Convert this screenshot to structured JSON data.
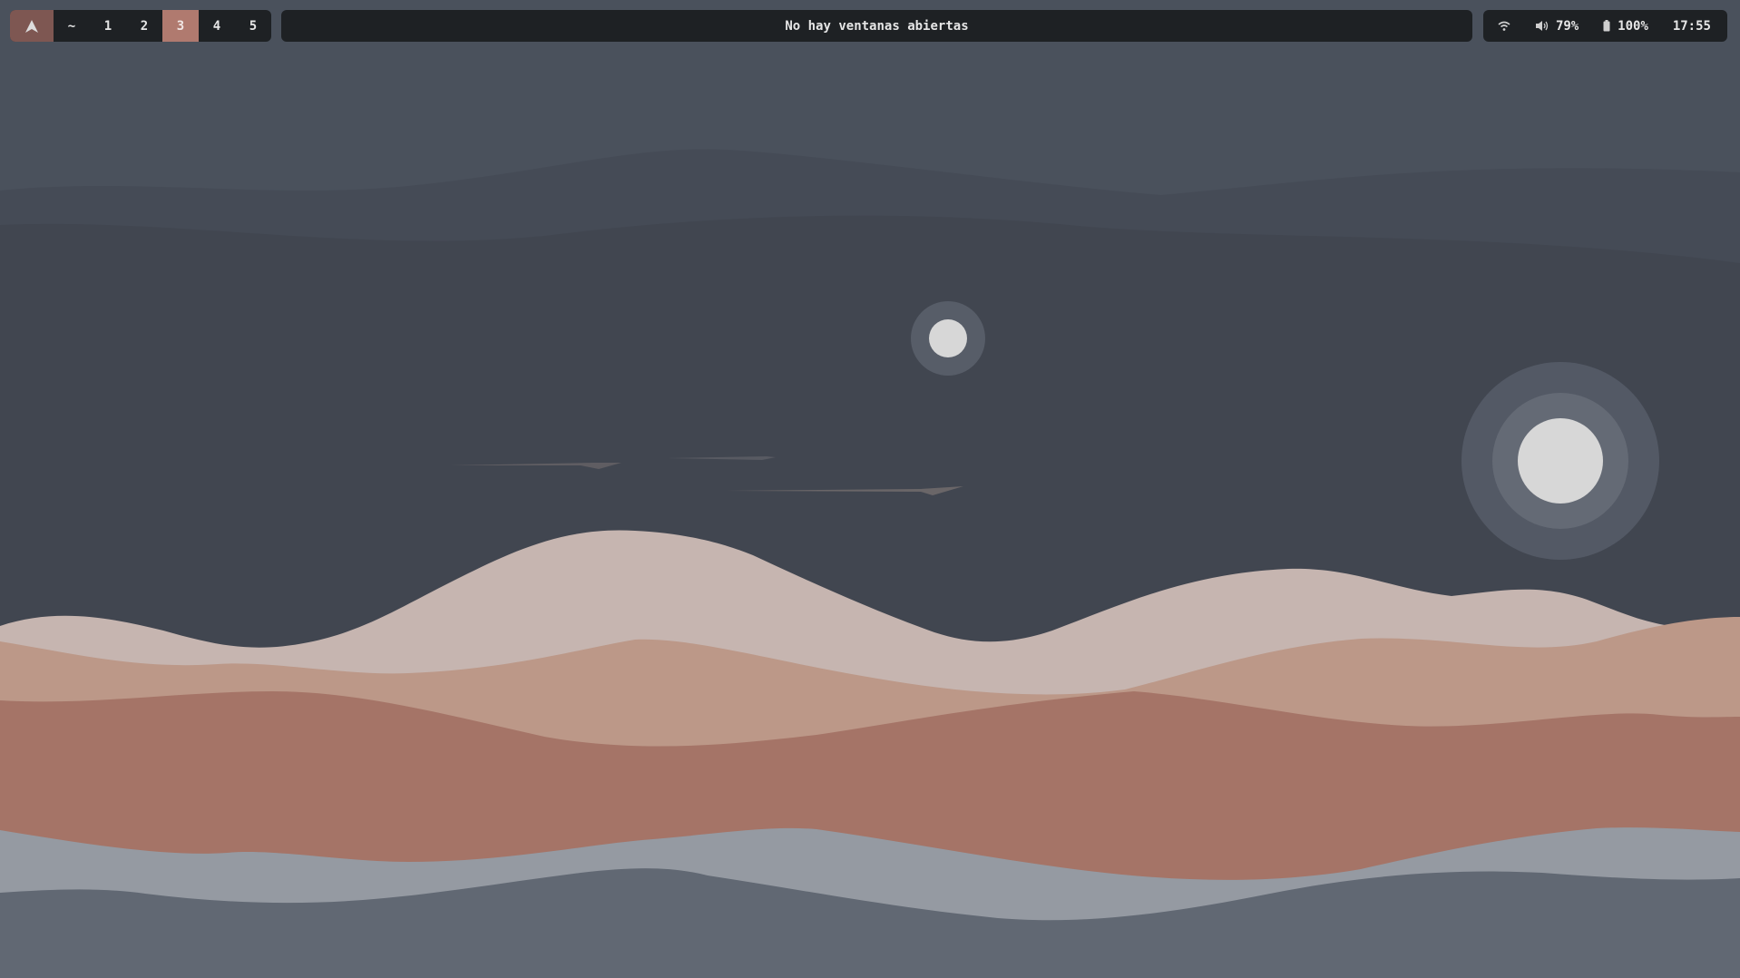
{
  "workspaces": {
    "logo_icon": "arch-logo-icon",
    "items": [
      {
        "label": "~"
      },
      {
        "label": "1"
      },
      {
        "label": "2"
      },
      {
        "label": "3",
        "active": true
      },
      {
        "label": "4"
      },
      {
        "label": "5"
      }
    ]
  },
  "window_title": "No hay ventanas abiertas",
  "status": {
    "wifi_icon": "wifi-icon",
    "volume_icon": "volume-icon",
    "volume": "79%",
    "battery_icon": "battery-icon",
    "battery": "100%",
    "clock": "17:55"
  },
  "colors": {
    "bar_bg": "#1e2124",
    "active_workspace": "#b07a6f",
    "logo_bg": "#7e5752",
    "sky_top": "#4a515c",
    "sky_bottom": "#414650",
    "dune_light": "#c6b5b0",
    "dune_mid": "#bc9888",
    "dune_dark": "#a57467",
    "ground_light": "#959aa2",
    "ground_dark": "#616873"
  }
}
